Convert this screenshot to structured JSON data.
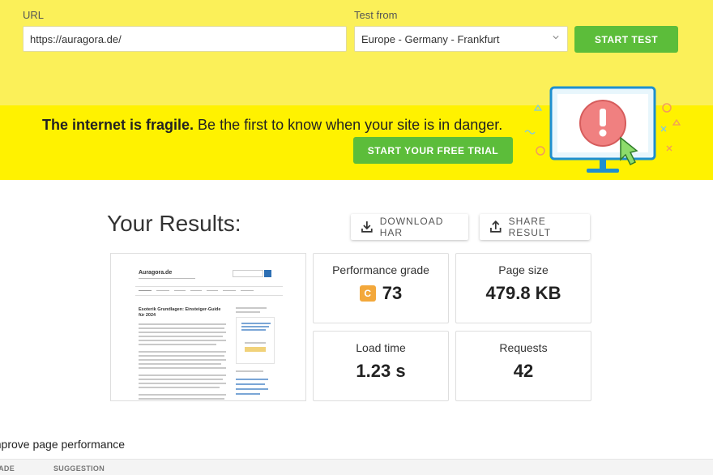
{
  "form": {
    "url_label": "URL",
    "url_value": "https://auragora.de/",
    "test_from_label": "Test from",
    "test_from_value": "Europe - Germany - Frankfurt",
    "start_test_label": "START TEST"
  },
  "banner": {
    "headline_bold": "The internet is fragile.",
    "headline_rest": " Be the first to know when your site is in danger.",
    "trial_button_label": "START YOUR FREE TRIAL"
  },
  "results": {
    "title": "Your Results:",
    "download_har_label": "DOWNLOAD HAR",
    "share_result_label": "SHARE RESULT",
    "screenshot": {
      "site_title": "Auragora.de",
      "article_title": "Esoterik Grundlagen: Einsteiger-Guide für 2024"
    },
    "metrics": {
      "performance_grade_label": "Performance grade",
      "performance_grade_letter": "C",
      "performance_grade_value": "73",
      "page_size_label": "Page size",
      "page_size_value": "479.8 KB",
      "load_time_label": "Load time",
      "load_time_value": "1.23 s",
      "requests_label": "Requests",
      "requests_value": "42"
    }
  },
  "improve": {
    "heading": "Improve page performance",
    "columns": [
      "GRADE",
      "SUGGESTION"
    ]
  },
  "colors": {
    "top_bg": "#fbf059",
    "banner_bg": "#fff200",
    "green": "#5cbd3a",
    "grade_c": "#f3a83b"
  }
}
